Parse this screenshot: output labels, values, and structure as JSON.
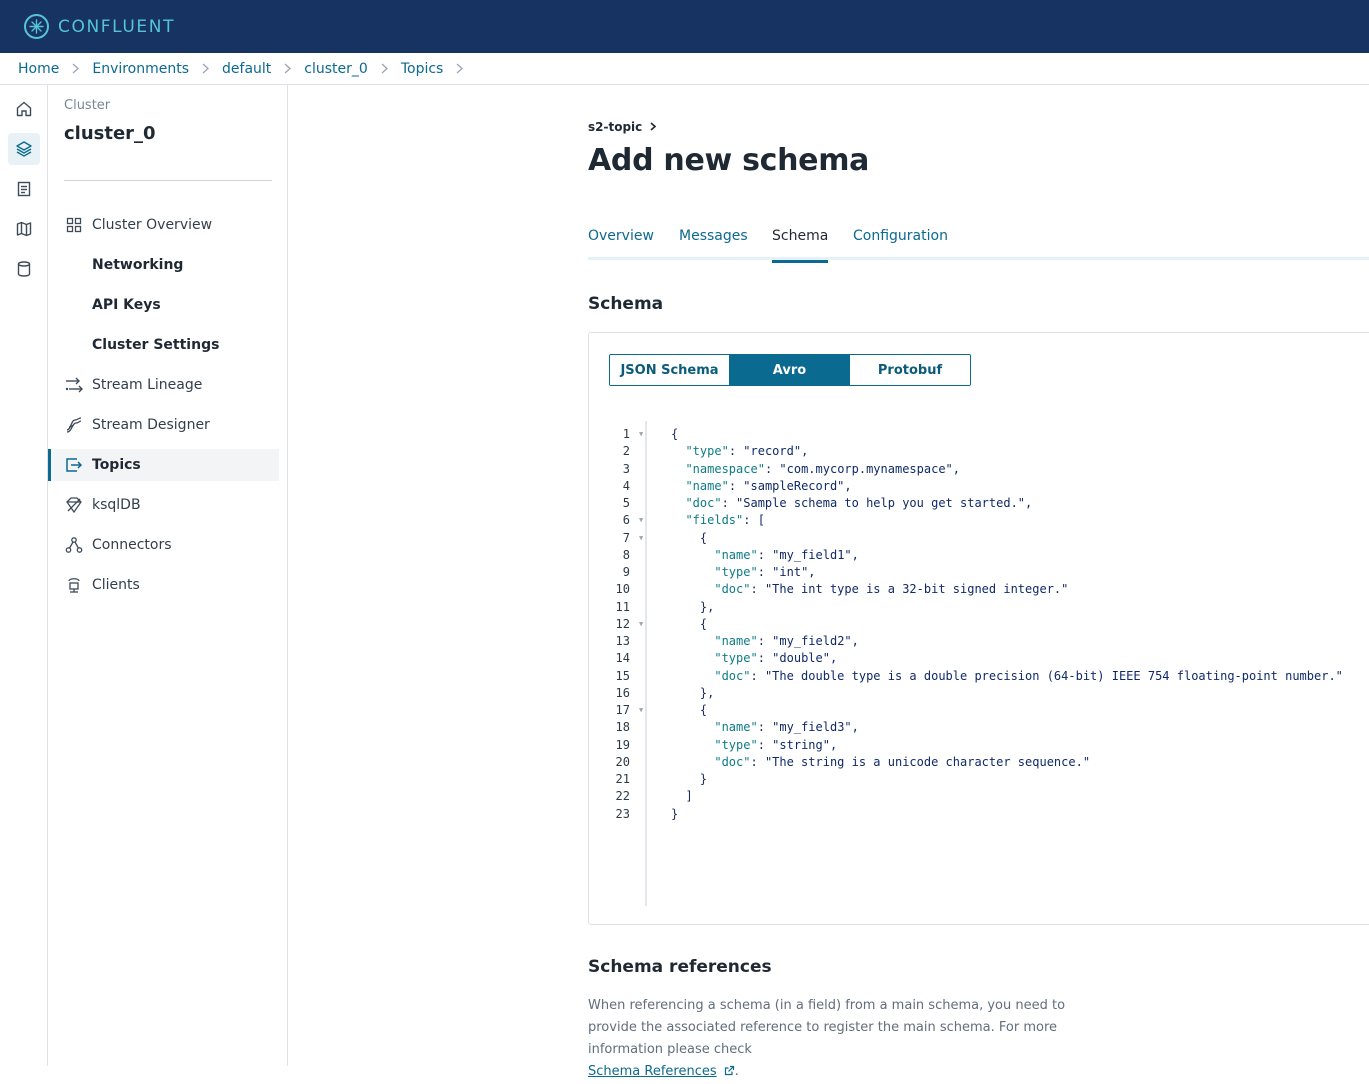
{
  "app": {
    "logo_text": "CONFLUENT",
    "brand_color": "#173361",
    "accent_color": "#0b6a8f"
  },
  "breadcrumb": [
    "Home",
    "Environments",
    "default",
    "cluster_0",
    "Topics"
  ],
  "rail": [
    "home-icon",
    "layers-icon",
    "document-icon",
    "map-icon",
    "database-icon"
  ],
  "sidenav": {
    "label": "Cluster",
    "title": "cluster_0",
    "items": [
      {
        "label": "Cluster Overview",
        "icon": "grid-icon"
      },
      {
        "label": "Networking",
        "icon": ""
      },
      {
        "label": "API Keys",
        "icon": ""
      },
      {
        "label": "Cluster Settings",
        "icon": ""
      },
      {
        "label": "Stream Lineage",
        "icon": "lineage-icon"
      },
      {
        "label": "Stream Designer",
        "icon": "designer-icon"
      },
      {
        "label": "Topics",
        "icon": "topics-icon"
      },
      {
        "label": "ksqlDB",
        "icon": "ksqldb-icon"
      },
      {
        "label": "Connectors",
        "icon": "connectors-icon"
      },
      {
        "label": "Clients",
        "icon": "clients-icon"
      }
    ]
  },
  "main": {
    "topic": "s2-topic",
    "title": "Add new schema",
    "tabs": [
      "Overview",
      "Messages",
      "Schema",
      "Configuration"
    ],
    "active_tab": "Schema",
    "schema_heading": "Schema",
    "format_options": [
      "JSON Schema",
      "Avro",
      "Protobuf"
    ],
    "selected_format": "Avro",
    "code_lines": [
      "{",
      "  \"type\": \"record\",",
      "  \"namespace\": \"com.mycorp.mynamespace\",",
      "  \"name\": \"sampleRecord\",",
      "  \"doc\": \"Sample schema to help you get started.\",",
      "  \"fields\": [",
      "    {",
      "      \"name\": \"my_field1\",",
      "      \"type\": \"int\",",
      "      \"doc\": \"The int type is a 32-bit signed integer.\"",
      "    },",
      "    {",
      "      \"name\": \"my_field2\",",
      "      \"type\": \"double\",",
      "      \"doc\": \"The double type is a double precision (64-bit) IEEE 754 floating-point number.\"",
      "    },",
      "    {",
      "      \"name\": \"my_field3\",",
      "      \"type\": \"string\",",
      "      \"doc\": \"The string is a unicode character sequence.\"",
      "    }",
      "  ]",
      "}"
    ],
    "fold_lines": [
      1,
      6,
      7,
      12,
      17
    ],
    "refs_heading": "Schema references",
    "refs_text_1": "When referencing a schema (in a field) from a main schema, you need to provide the associated reference to register the main schema. For more information please check",
    "refs_link": "Schema References",
    "refs_text_end": "."
  }
}
